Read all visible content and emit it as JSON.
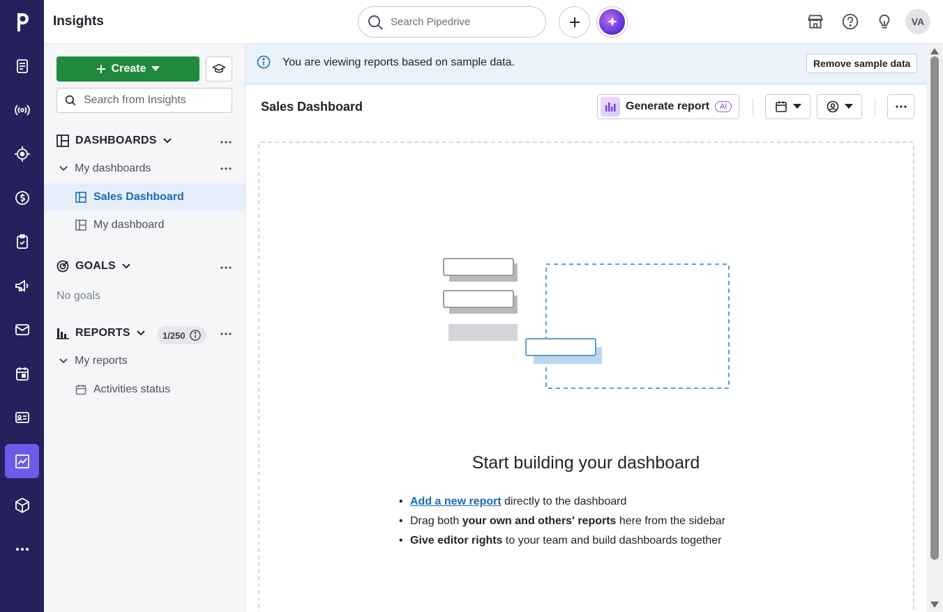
{
  "app": {
    "title": "Insights",
    "avatar_initials": "VA"
  },
  "topbar": {
    "search_placeholder": "Search Pipedrive",
    "icons": [
      "search-icon",
      "plus-icon",
      "ai-sparkle-icon",
      "marketplace-icon",
      "help-icon",
      "lightbulb-icon"
    ]
  },
  "rail": {
    "items": [
      "logo",
      "leads",
      "broadcast",
      "target",
      "deals",
      "tasks",
      "campaigns",
      "mail",
      "calendar",
      "contacts",
      "insights",
      "products",
      "more"
    ],
    "active": "insights",
    "bg_color": "#26215c",
    "active_color": "#6b5ce7"
  },
  "sidebar": {
    "create_label": "Create",
    "search_placeholder": "Search from Insights",
    "dashboards": {
      "title": "DASHBOARDS",
      "group_label": "My dashboards",
      "items": [
        {
          "label": "Sales Dashboard",
          "active": true
        },
        {
          "label": "My dashboard",
          "active": false
        }
      ]
    },
    "goals": {
      "title": "GOALS",
      "empty_text": "No goals"
    },
    "reports": {
      "title": "REPORTS",
      "count": "1/250",
      "group_label": "My reports",
      "items": [
        {
          "label": "Activities status"
        }
      ]
    }
  },
  "banner": {
    "text": "You are viewing reports based on sample data.",
    "button_label": "Remove sample data"
  },
  "dashboard": {
    "title": "Sales Dashboard",
    "generate_label": "Generate report",
    "ai_tag": "AI",
    "empty_title": "Start building your dashboard",
    "tips": {
      "t1_link": "Add a new report",
      "t1_rest": " directly to the dashboard",
      "t2_pre": "Drag both ",
      "t2_bold": "your own and others' reports",
      "t2_rest": " here from the sidebar",
      "t3_bold": "Give editor rights",
      "t3_rest": " to your team and build dashboards together"
    }
  },
  "colors": {
    "primary_green": "#1f8a3b",
    "link_blue": "#1b6ab3",
    "banner_bg": "#eaf3fc"
  }
}
